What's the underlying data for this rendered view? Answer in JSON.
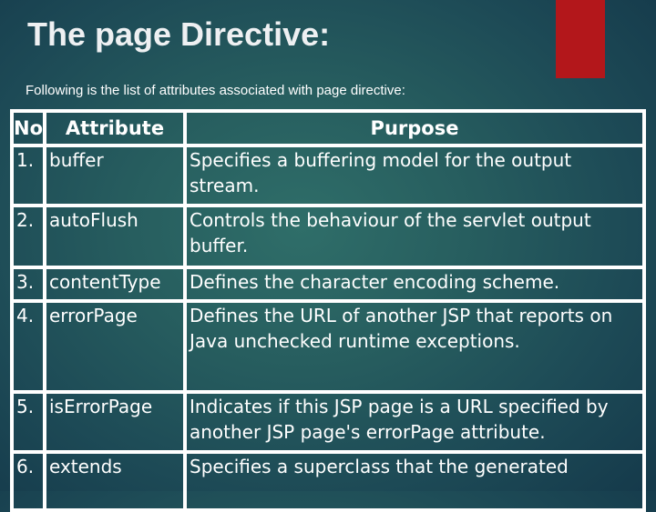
{
  "slide": {
    "title": "The page Directive:",
    "subtitle": "Following is the list of attributes associated with page directive:",
    "accent_color": "#b3171b",
    "background_center": "#2f6e69",
    "background_edge": "#153a4b"
  },
  "table": {
    "headers": {
      "no": "No",
      "attribute": "Attribute",
      "purpose": "Purpose"
    },
    "rows": [
      {
        "no": "1.",
        "attribute": "buffer",
        "purpose": "Specifies a buffering model for the output stream."
      },
      {
        "no": "2.",
        "attribute": "autoFlush",
        "purpose": "Controls the behaviour of the servlet output buffer."
      },
      {
        "no": "3.",
        "attribute": "contentType",
        "purpose": "Defines the character encoding scheme."
      },
      {
        "no": "4.",
        "attribute": "errorPage",
        "purpose": "Defines the URL of another JSP that reports on Java unchecked runtime exceptions."
      },
      {
        "no": "5.",
        "attribute": "isErrorPage",
        "purpose": "Indicates if this JSP page is a URL specified by another JSP page's errorPage attribute."
      },
      {
        "no": "6.",
        "attribute": "extends",
        "purpose": "Specifies a superclass that the generated"
      }
    ]
  }
}
